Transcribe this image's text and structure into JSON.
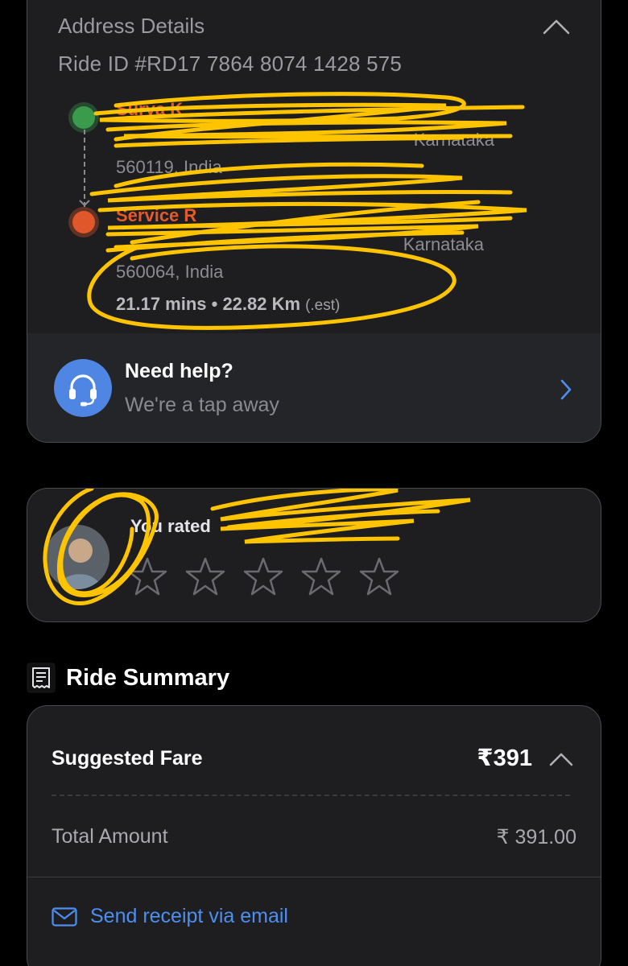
{
  "address": {
    "title": "Address Details",
    "ride_id": "Ride ID #RD17 7864 8074 1428 575",
    "pickup": {
      "name": "Surya K",
      "address_line1": "Karnataka",
      "address_line2": "560119, India"
    },
    "drop": {
      "name": "Service R",
      "address_line1": "Karnataka",
      "address_line2": "560064, India"
    },
    "eta": "21.17 mins • 22.82 Km",
    "eta_suffix": "(.est)"
  },
  "help": {
    "title": "Need help?",
    "subtitle": "We're a tap away"
  },
  "rating": {
    "label": "You rated",
    "stars_filled": 0,
    "stars_total": 5
  },
  "summary": {
    "title": "Ride Summary",
    "fare_label": "Suggested Fare",
    "fare_value": "₹391",
    "total_label": "Total Amount",
    "total_value": "₹ 391.00",
    "send_receipt": "Send receipt via email"
  },
  "colors": {
    "background": "#000000",
    "card": "#1e1e20",
    "accent_blue": "#4d8ff0",
    "pickup_green": "#3a9b4d",
    "drop_orange": "#e0572a",
    "scribble_yellow": "#ffc400"
  }
}
